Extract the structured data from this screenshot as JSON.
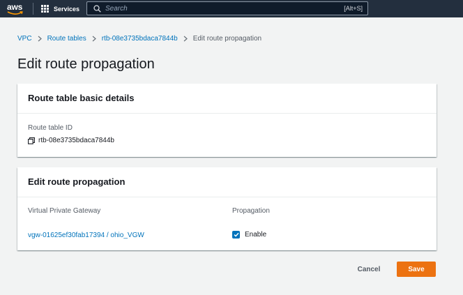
{
  "topbar": {
    "logo_text": "aws",
    "services_label": "Services",
    "search": {
      "placeholder": "Search",
      "shortcut": "[Alt+S]"
    }
  },
  "breadcrumb": {
    "items": [
      "VPC",
      "Route tables",
      "rtb-08e3735bdaca7844b"
    ],
    "current": "Edit route propagation"
  },
  "page_title": "Edit route propagation",
  "basic_details": {
    "title": "Route table basic details",
    "route_table_id_label": "Route table ID",
    "route_table_id": "rtb-08e3735bdaca7844b"
  },
  "propagation": {
    "title": "Edit route propagation",
    "col_gateway": "Virtual Private Gateway",
    "col_propagation": "Propagation",
    "rows": [
      {
        "gateway": "vgw-01625ef30fab17394 / ohio_VGW",
        "enable_label": "Enable",
        "enabled": true
      }
    ]
  },
  "actions": {
    "cancel": "Cancel",
    "save": "Save"
  },
  "colors": {
    "nav": "#232f3e",
    "link": "#0073bb",
    "primary": "#ec7211",
    "background": "#f2f3f3"
  }
}
